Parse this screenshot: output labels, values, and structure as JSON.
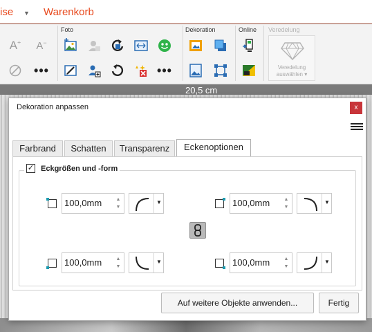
{
  "menu": {
    "item_left": "ise",
    "item_warenkorb": "Warenkorb"
  },
  "ribbon": {
    "groups": {
      "foto": "Foto",
      "dekoration": "Dekoration",
      "online": "Online",
      "veredelung": "Veredelung"
    },
    "veredelung_button": {
      "line1": "Veredelung",
      "line2": "auswählen"
    }
  },
  "ruler": {
    "label": "20,5 cm"
  },
  "dialog": {
    "title": "Dekoration anpassen",
    "close_glyph": "x",
    "tabs": [
      "Farbrand",
      "Schatten",
      "Transparenz",
      "Eckenoptionen"
    ],
    "active_tab": "Eckenoptionen",
    "section": {
      "checked": true,
      "check_glyph": "✓",
      "label": "Eckgrößen und -form"
    },
    "corners": {
      "top_left": {
        "value": "100,0mm"
      },
      "top_right": {
        "value": "100,0mm"
      },
      "bottom_left": {
        "value": "100,0mm"
      },
      "bottom_right": {
        "value": "100,0mm"
      }
    },
    "buttons": {
      "apply_all": "Auf weitere Objekte anwenden...",
      "done": "Fertig"
    }
  },
  "colors": {
    "brand": "#e8491d",
    "corner_marker": "#1c9bb0",
    "close_button": "#c8353a"
  }
}
